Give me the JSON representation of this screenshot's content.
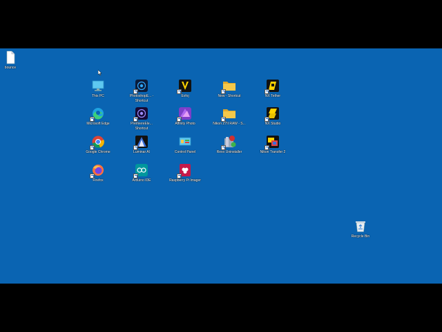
{
  "desktop_icons": {
    "bounce": "bounce",
    "this_pc": "This PC",
    "edge": "Microsoft Edge",
    "chrome": "Google Chrome",
    "firefox": "Firefox",
    "photoshop": "PhotoshopE... - Shortcut",
    "premiere": "PremiereEle... Shortcut",
    "luminar": "Luminar AI",
    "arduino": "Arduino IDE",
    "expo": "Exfoj",
    "affinity": "Affinity Photo",
    "control_panel": "Control Panel",
    "rpi_imager": "Raspberry Pi Imager",
    "new_shortcut": "New - Shortcut",
    "nikon_raw": "Nikon Z7II RAW - S...",
    "revo": "Revo Uninstaller",
    "nx_tether": "NX Tether",
    "nx_studio": "NX Studio",
    "nikon_transfer": "Nikon Transfer 2",
    "recycle_bin": "Recycle Bin"
  },
  "icon_names": {
    "bounce": "document-icon",
    "this_pc": "monitor-icon",
    "edge": "edge-icon",
    "chrome": "chrome-icon",
    "firefox": "firefox-icon",
    "photoshop": "photoshop-elements-icon",
    "premiere": "premiere-elements-icon",
    "luminar": "luminar-icon",
    "arduino": "arduino-icon",
    "expo": "expo-icon",
    "affinity": "affinity-photo-icon",
    "control_panel": "control-panel-icon",
    "rpi_imager": "raspberry-pi-icon",
    "new_shortcut": "folder-icon",
    "nikon_raw": "folder-icon",
    "revo": "revo-uninstaller-icon",
    "nx_tether": "nx-tether-icon",
    "nx_studio": "nx-studio-icon",
    "nikon_transfer": "nikon-transfer-icon",
    "recycle_bin": "recycle-bin-icon"
  },
  "colors": {
    "desktop_bg": "#0a64b2",
    "letterbox": "#000000",
    "folder": "#f5c84a"
  }
}
